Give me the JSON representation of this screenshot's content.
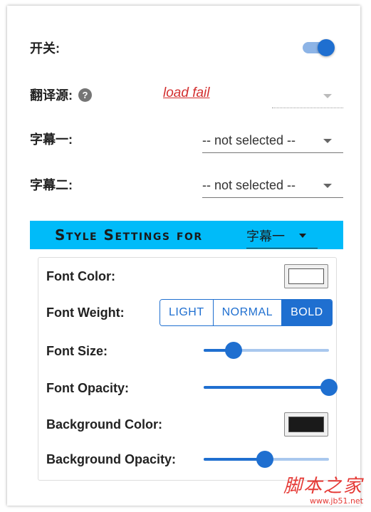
{
  "main": {
    "toggle_label": "开关:",
    "toggle_on": true,
    "source_label": "翻译源:",
    "help_glyph": "?",
    "source_error": "load fail",
    "subtitle1_label": "字幕一:",
    "subtitle1_value": "-- not selected --",
    "subtitle2_label": "字幕二:",
    "subtitle2_value": "-- not selected --"
  },
  "style": {
    "title": "Style Settings for",
    "target": "字幕一",
    "font_color_label": "Font Color:",
    "font_color": "#ffffff",
    "font_weight_label": "Font Weight:",
    "weights": [
      "LIGHT",
      "NORMAL",
      "BOLD"
    ],
    "selected_weight": "BOLD",
    "font_size_label": "Font Size:",
    "font_size_level": 0.24,
    "font_opacity_label": "Font Opacity:",
    "font_opacity_level": 1.0,
    "bg_color_label": "Background Color:",
    "bg_color": "#1a1a1a",
    "bg_opacity_label": "Background Opacity:",
    "bg_opacity_level": 0.49
  },
  "colors": {
    "accent": "#1f6fd0",
    "header_bg": "#00bbf9",
    "error": "#d32f2f"
  },
  "watermark": {
    "brand": "脚本之家",
    "url": "www.jb51.net"
  }
}
